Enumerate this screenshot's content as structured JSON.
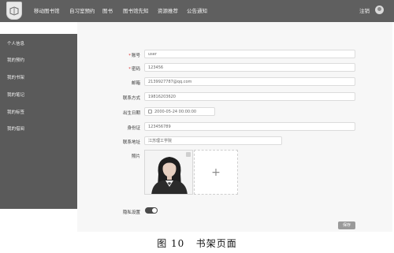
{
  "header": {
    "logo_text": "移动图书馆",
    "nav": [
      {
        "label": "移动图书馆"
      },
      {
        "label": "自习室预约"
      },
      {
        "label": "图书"
      },
      {
        "label": "图书馆先知"
      },
      {
        "label": "资源推荐"
      },
      {
        "label": "公告通知"
      }
    ],
    "logout_label": "注销",
    "user_icon": "user-icon"
  },
  "sidebar": {
    "items": [
      {
        "label": "个人信息"
      },
      {
        "label": "我的预约"
      },
      {
        "label": "我的书架"
      },
      {
        "label": "我的笔记"
      },
      {
        "label": "我的标签"
      },
      {
        "label": "我的借阅"
      }
    ]
  },
  "form": {
    "account": {
      "label": "账号",
      "value": "user",
      "required": true
    },
    "password": {
      "label": "密码",
      "value": "123456",
      "required": true
    },
    "email": {
      "label": "邮箱",
      "value": "2139927787@qq.com"
    },
    "phone": {
      "label": "联系方式",
      "value": "19816203620"
    },
    "birthday": {
      "label": "出生日期",
      "value": "2000-05-24 00:00:00",
      "icon": "calendar-icon"
    },
    "id_card": {
      "label": "身份证",
      "value": "123456789"
    },
    "address": {
      "label": "联系地址",
      "value": "江苏理工学院"
    },
    "photo": {
      "label": "照片",
      "upload_icon": "plus-icon"
    },
    "privacy": {
      "label": "隐私设置",
      "enabled": true
    }
  },
  "actions": {
    "save_label": "保存"
  },
  "caption": "图 10   书架页面",
  "colors": {
    "topbar": "#5f5f5f",
    "sidebar": "#5a5a5a",
    "panel": "#f7f7f7",
    "toggle_on": "#4a4a4a",
    "button": "#9a9a9a"
  }
}
